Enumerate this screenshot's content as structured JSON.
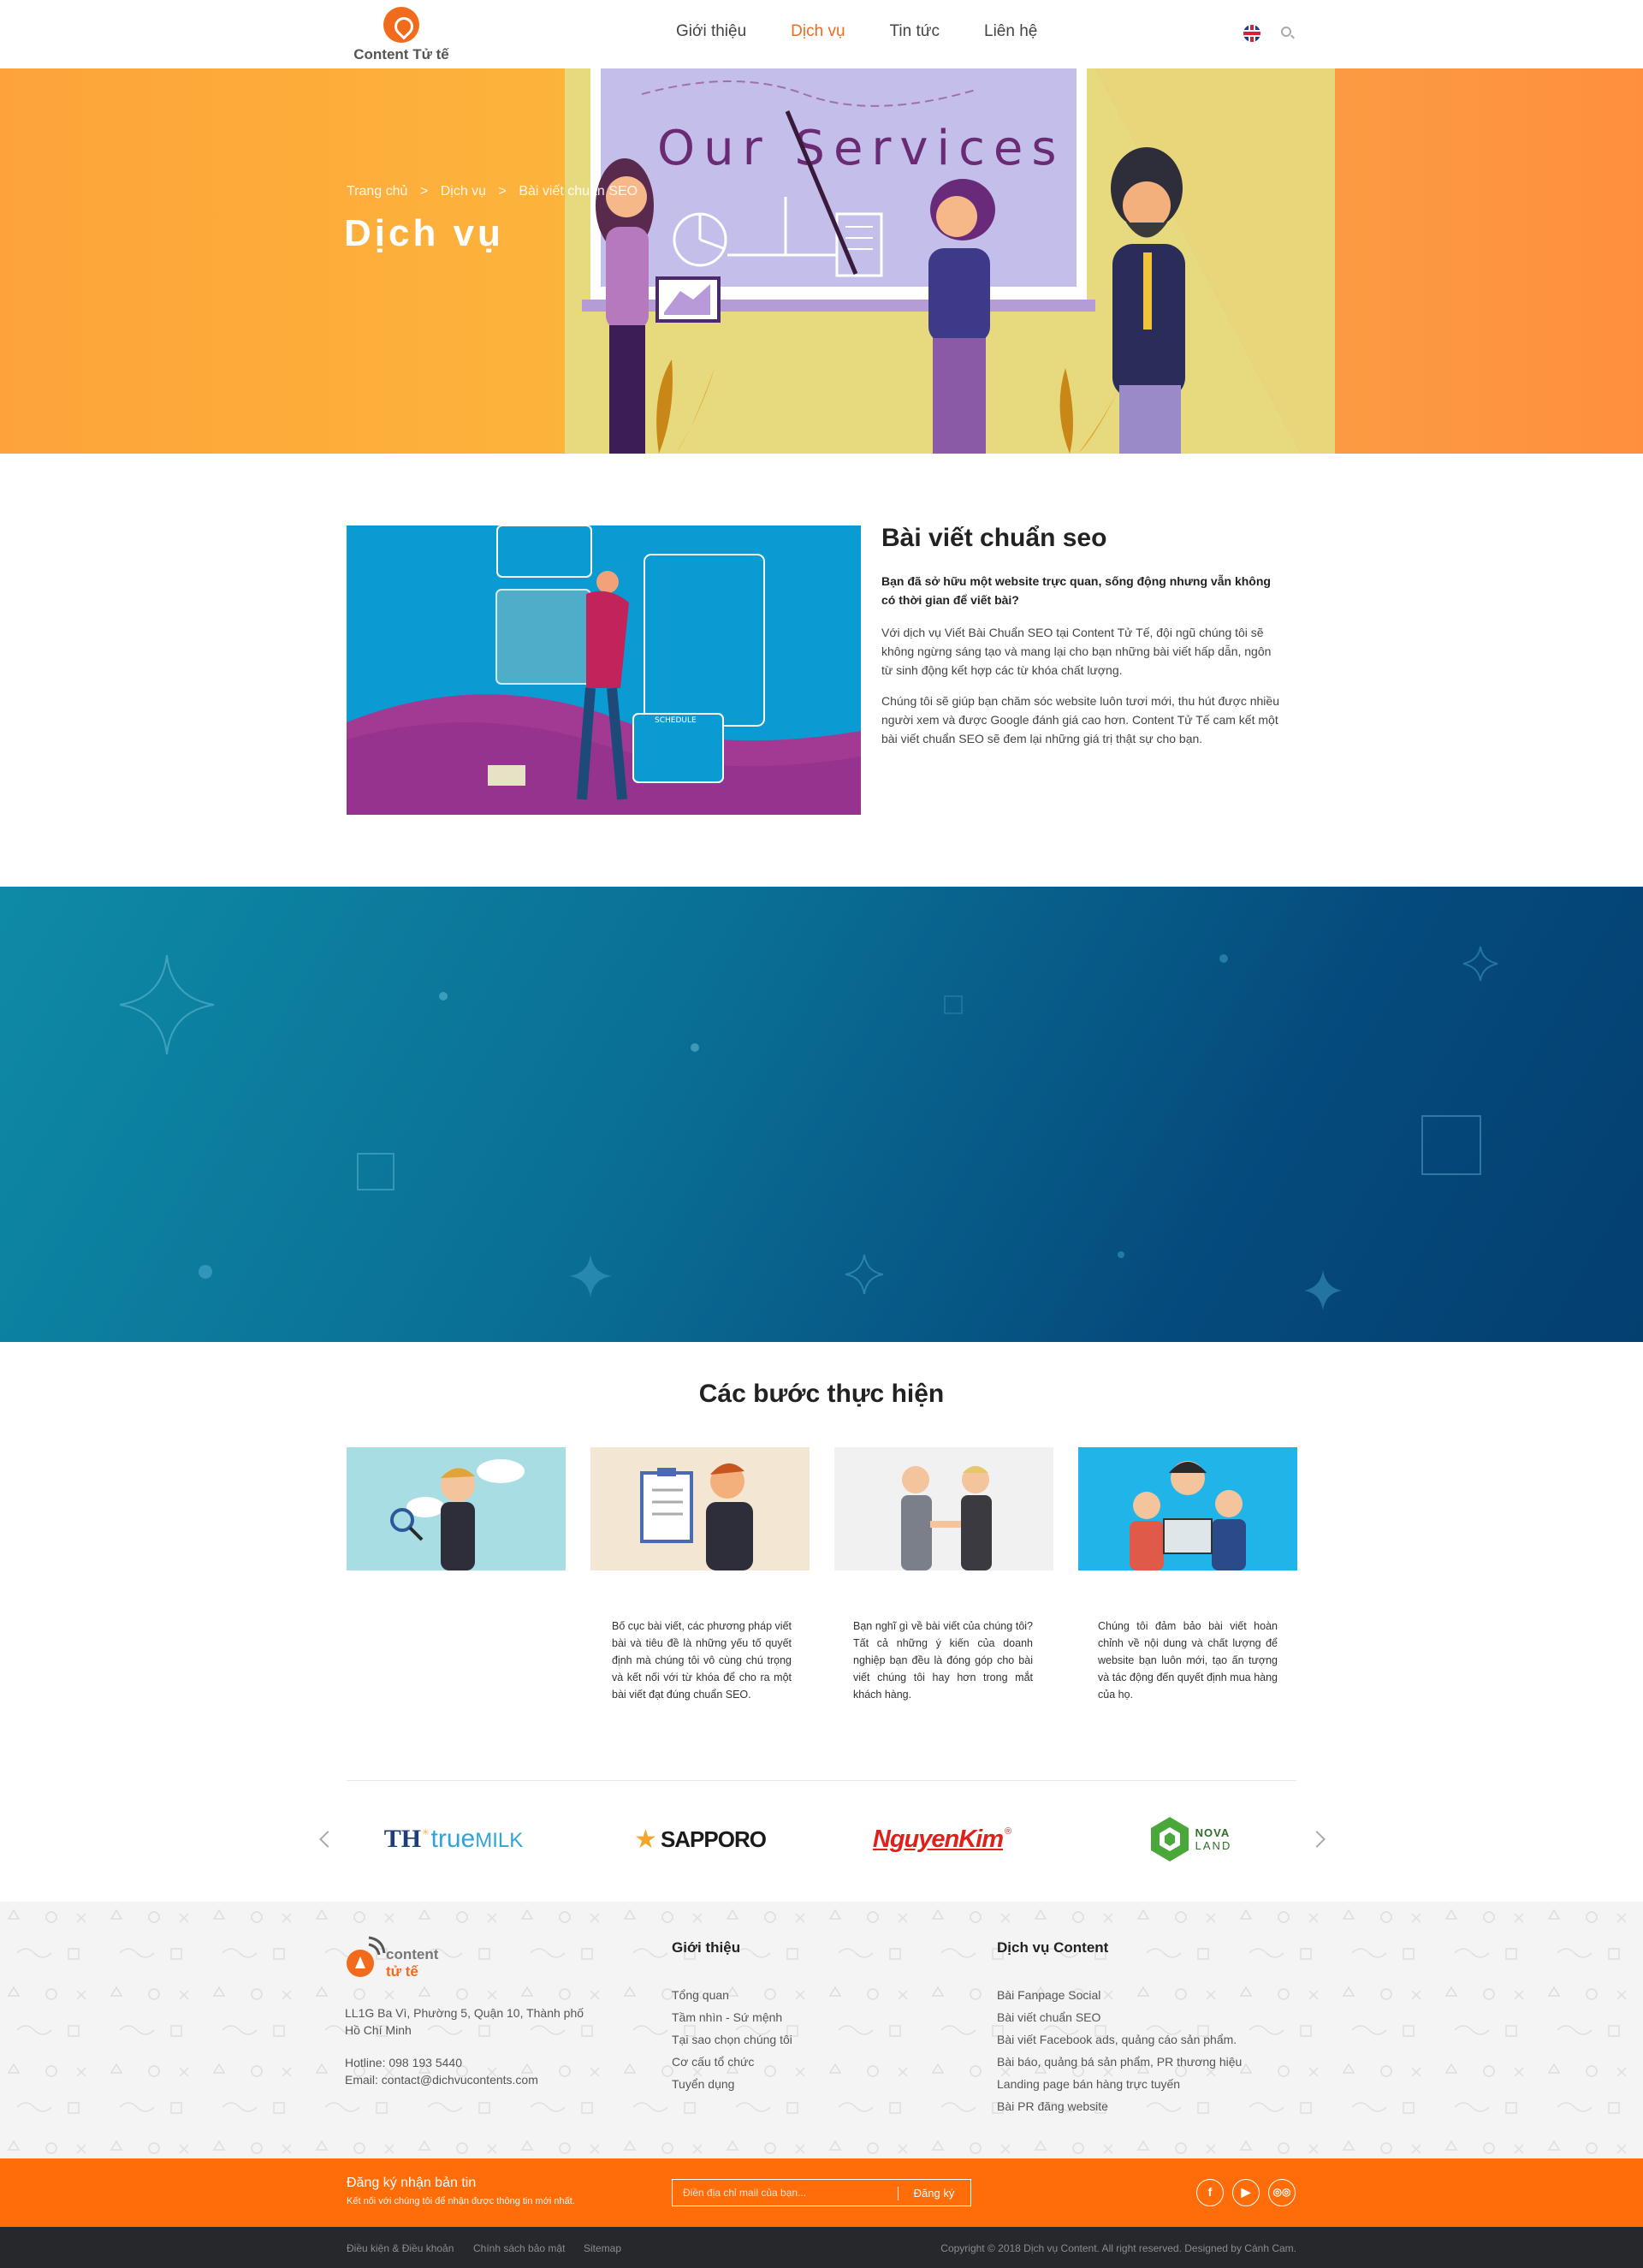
{
  "header": {
    "logo_text": "Content Tử tế",
    "nav": [
      "Giới thiệu",
      "Dịch vụ",
      "Tin tức",
      "Liên hệ"
    ],
    "active_nav": "Dịch vụ"
  },
  "hero": {
    "board_text": "Our Services",
    "breadcrumb": [
      "Trang chủ",
      ">",
      "Dịch vụ",
      ">",
      "Bài viết chuẩn SEO"
    ],
    "title": "Dịch vụ"
  },
  "intro": {
    "image_label": "SCHEDULE",
    "title": "Bài viết chuẩn seo",
    "lead": "Bạn đã sở hữu một website trực quan, sống động nhưng vẫn không có thời gian để viết bài?",
    "p1": "Với dịch vụ Viết Bài Chuẩn SEO tại Content Tử Tế, đội ngũ chúng tôi sẽ không ngừng sáng tạo và mang lại cho bạn những bài viết hấp dẫn, ngôn từ sinh động kết hợp các từ khóa chất lượng.",
    "p2": "Chúng tôi sẽ giúp bạn chăm sóc website luôn tươi mới, thu hút được nhiều người xem và được Google đánh giá cao hơn. Content Tử Tế cam kết một bài viết chuẩn SEO sẽ đem lại những giá trị thật sự cho bạn."
  },
  "steps": {
    "title": "Các bước thực hiện",
    "items": [
      {
        "text": ""
      },
      {
        "text": "Bố cục bài viết, các phương pháp viết bài và tiêu đề là những yếu tố quyết định mà chúng tôi vô cùng chú trọng và kết nối với từ khóa để cho ra một bài viết đạt đúng chuẩn SEO."
      },
      {
        "text": "Bạn nghĩ gì về bài viết của chúng tôi? Tất cả những ý kiến của doanh nghiệp bạn đều là đóng góp cho bài viết chúng tôi hay hơn trong mắt khách hàng."
      },
      {
        "text": "Chúng tôi đảm bảo bài viết hoàn chỉnh về nội dung và chất lượng để website bạn luôn mới, tạo ấn tượng và tác động đến quyết định mua hàng của họ."
      }
    ]
  },
  "clients": {
    "th": "TH",
    "truemilk_a": "true",
    "truemilk_b": "MILK",
    "sapporo": "SAPPORO",
    "nguyenkim": "NguyenKim",
    "nova_a": "NOVA",
    "nova_b": "LAND"
  },
  "footer": {
    "logo_a": "content",
    "logo_b": "tử tế",
    "address": "LL1G Ba Vì, Phường 5, Quận 10, Thành phố Hồ Chí Minh",
    "hotline": "Hotline: 098 193 5440",
    "email": "Email: contact@dichvucontents.com",
    "col1_title": "Giới thiệu",
    "col1_links": [
      "Tổng quan",
      "Tầm nhìn - Sứ mệnh",
      "Tại sao chọn chúng tôi",
      "Cơ cấu tổ chức",
      "Tuyển dụng"
    ],
    "col2_title": "Dịch vụ Content",
    "col2_links": [
      "Bài Fanpage Social",
      "Bài viết chuẩn SEO",
      "Bài viết Facebook ads, quảng cáo sản phẩm.",
      "Bài báo, quảng bá sản phẩm, PR thương hiệu",
      "Landing page bán hàng trực tuyến",
      "Bài PR đăng website"
    ]
  },
  "newsletter": {
    "title": "Đăng ký nhận bản tin",
    "subtitle": "Kết nối với chúng tôi để nhận được thông tin mới nhất.",
    "placeholder": "Điền địa chỉ mail của bạn...",
    "button": "Đăng ký",
    "social_icons": [
      "facebook-icon",
      "youtube-icon",
      "tripadvisor-icon"
    ]
  },
  "bottombar": {
    "links": [
      "Điều kiện & Điều khoản",
      "Chính sách bảo mật",
      "Sitemap"
    ],
    "copyright": "Copyright © 2018 Dịch vụ Content. All right reserved. Designed by Cánh Cam."
  },
  "colors": {
    "accent": "#f26b1d",
    "newsletter_bg": "#ff6c0a",
    "band_start": "#0e8aa6",
    "band_end": "#043f70"
  }
}
